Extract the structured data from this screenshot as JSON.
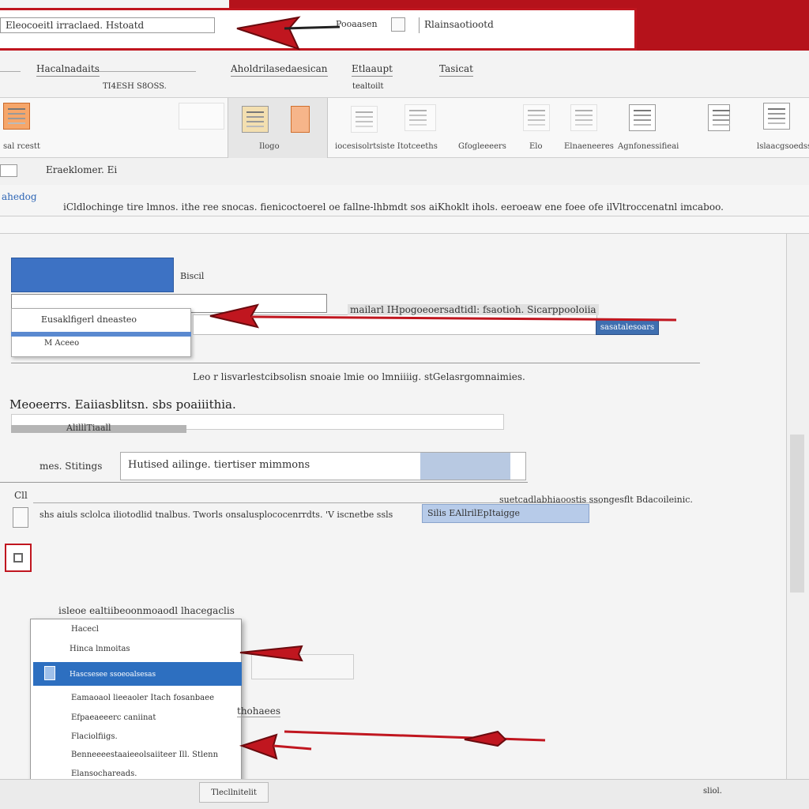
{
  "window": {
    "title_field": "Eleocoeitl irraclaed. Hstoatd",
    "title_mid": "Pooaasen",
    "title_right": "Rlainsaotiootd"
  },
  "tabs": [
    {
      "label": "Hacalnadaits"
    },
    {
      "label": "Aholdrilasedaesican"
    },
    {
      "label": "Etlaaupt"
    },
    {
      "label": "Tasicat"
    }
  ],
  "tab_subs": [
    "TI4ESH S8OSS.",
    "tealtoilt"
  ],
  "ribbon": {
    "items": [
      {
        "label": "sal rcestt",
        "icon": "document-orange-icon"
      },
      {
        "label": "",
        "icon": "blank-icon"
      },
      {
        "label": "Ilogo",
        "icon": "image-icon"
      },
      {
        "label": "",
        "icon": "shape-orange-icon"
      },
      {
        "label": "iocesisolrtsiste Itotceeths",
        "icon": "table-icon"
      },
      {
        "label": "Gfogleeeers",
        "icon": "chart-icon"
      },
      {
        "label": "Elo",
        "icon": "page-icon"
      },
      {
        "label": "Elnaeneeres",
        "icon": "list-icon"
      },
      {
        "label": "Agnfonessifieai",
        "icon": "form-icon"
      },
      {
        "label": "",
        "icon": "warning-icon"
      },
      {
        "label": "lslaacgsoedss",
        "icon": "document-stack-icon"
      }
    ]
  },
  "namebox": "Eraeklomer. Ei",
  "desc": {
    "link": "ahedog",
    "text": "iCldlochinge tire lmnos. ithe ree snocas.   fienicoctoerel oe fallne-lhbmdt sos   aiKhoklt ihols.   eeroeaw ene foee ofe   ilVltroccenatnl imcaboo."
  },
  "dropdown1": {
    "head_label": "Biscil",
    "items": [
      "Eusaklfigerl dneasteo",
      "M Aceeo"
    ]
  },
  "field_long": {
    "text": "mailarl IHpogoeoersadtidl: fsaotioh. Sicarppooloiia",
    "button": "sasatalesoars"
  },
  "note1": "Leo r lisvarlestcibsolisn snoaie lmie oo lmniiiig. stGelasrgomnaimies.",
  "heading1": "Meoeerrs. Eaiiasblitsn. sbs poaiiithia.",
  "bar1_text": "AlilllTiaall",
  "row_label": "mes. Stitings",
  "input_main": "Hutised ailinge. tiertiser mimmons",
  "row2": {
    "label": "Cll",
    "right": "suetcadlabhiaoostis ssongesflt Bdacoileinic."
  },
  "row3": {
    "text": "shs aiuls sclolca iliotodlid tnalbus. Tworls onsalusplococenrrdts. 'V iscnetbe ssls"
  },
  "select_blue": "Silis EAllrilEpItaigge",
  "menu": {
    "caption": "isleoe ealtiibeoonmoaodl lhacegaclis",
    "items": [
      "Hacecl",
      "Hinca lnmoitas",
      "Hascsesee ssoeoalsesas",
      "Eamaoaol lieeaoler Itach fosanbaee",
      "Efpaeaeeerc caniinat",
      "Flaciolfiigs.",
      "Benneeeestaaieeolsaiiteer Ill. Stlenn",
      "Elansochareads."
    ]
  },
  "side_caption": "thohaees",
  "status": {
    "button": "Tlecllnitelit",
    "right": "sliol."
  },
  "colors": {
    "title_red": "#b5121b",
    "accent_blue": "#2d6fc0",
    "arrow_red": "#c0161f"
  }
}
